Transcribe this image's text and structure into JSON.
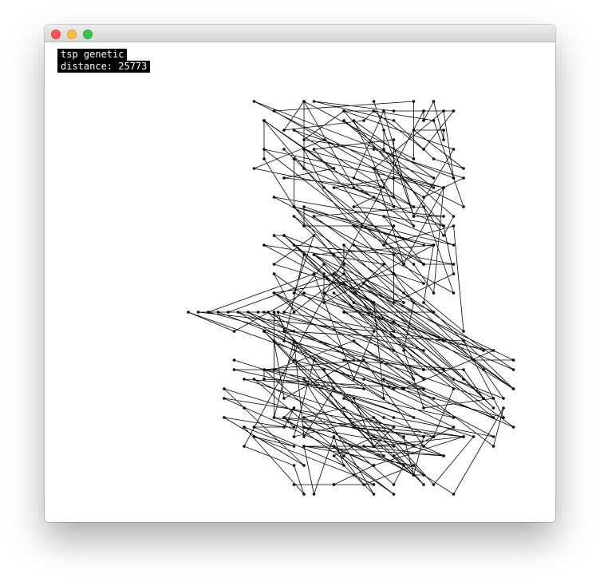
{
  "window": {
    "controls": [
      "close",
      "minimize",
      "maximize"
    ]
  },
  "hud": {
    "algorithm": "tsp genetic",
    "distance_label": "distance: 25773"
  },
  "colors": {
    "stroke": "#000000",
    "background": "#ffffff"
  }
}
